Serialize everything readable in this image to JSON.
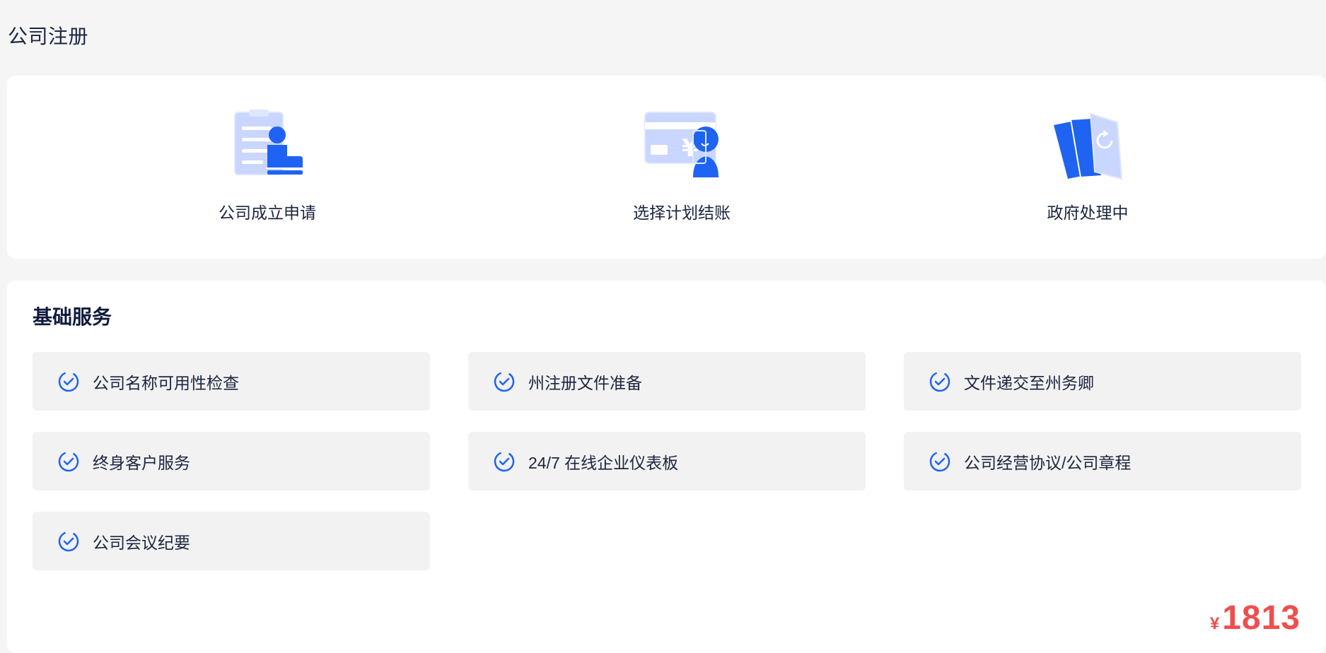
{
  "page": {
    "title": "公司注册"
  },
  "steps": [
    {
      "label": "公司成立申请",
      "icon": "application-form-icon"
    },
    {
      "label": "选择计划结账",
      "icon": "payment-card-icon"
    },
    {
      "label": "政府处理中",
      "icon": "documents-processing-icon"
    }
  ],
  "services": {
    "title": "基础服务",
    "items": [
      {
        "label": "公司名称可用性检查"
      },
      {
        "label": "州注册文件准备"
      },
      {
        "label": "文件递交至州务卿"
      },
      {
        "label": "终身客户服务"
      },
      {
        "label": "24/7 在线企业仪表板"
      },
      {
        "label": "公司经营协议/公司章程"
      },
      {
        "label": "公司会议纪要"
      }
    ]
  },
  "price": {
    "currency": "¥",
    "amount": "1813"
  },
  "colors": {
    "accent": "#1f63f2",
    "accent_light": "#c9d6ff",
    "price": "#f04e4e",
    "item_bg": "#f2f2f2"
  }
}
